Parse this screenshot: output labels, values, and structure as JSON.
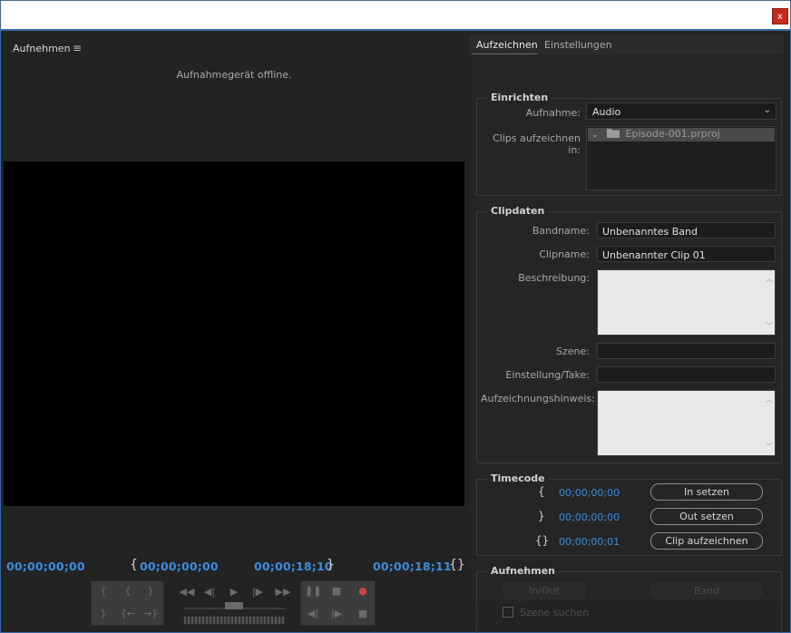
{
  "window": {
    "close_label": "x"
  },
  "panel": {
    "title": "Aufnehmen",
    "menu_icon": "≡",
    "status": "Aufnahmegerät offline."
  },
  "monitor": {
    "tc_left": "00;00;00;00",
    "tc_in": "00;00;00;00",
    "tc_out": "00;00;18;10",
    "tc_duration": "00;00;18;11",
    "in_bracket": "{",
    "out_bracket": "}",
    "dur_bracket": "{}"
  },
  "controls": {
    "set_in": "{",
    "set_out": "}",
    "rewind": "◀◀",
    "step_back": "◀|",
    "play": "▶",
    "step_fwd": "|▶",
    "ffwd": "▶▶",
    "pause": "❚❚",
    "stop": "■",
    "record": "●",
    "goto_in": "{←",
    "goto_out": "→}",
    "prev_scene": "◀|",
    "next_scene": "|▶"
  },
  "tabs": [
    "Aufzeichnen",
    "Einstellungen"
  ],
  "setup": {
    "legend": "Einrichten",
    "capture_label": "Aufnahme:",
    "capture_value": "Audio",
    "clips_label": "Clips aufzeichnen in:",
    "project": "Episode-001.prproj"
  },
  "clipdata": {
    "legend": "Clipdaten",
    "tape_label": "Bandname:",
    "tape_value": "Unbenanntes Band",
    "clip_label": "Clipname:",
    "clip_value": "Unbenannter Clip 01",
    "desc_label": "Beschreibung:",
    "scene_label": "Szene:",
    "shot_label": "Einstellung/Take:",
    "note_label": "Aufzeichnungshinweis:"
  },
  "timecode": {
    "legend": "Timecode",
    "in_value": "00;00;00;00",
    "out_value": "00;00;00;00",
    "dur_value": "00;00;00;01",
    "set_in_btn": "In setzen",
    "set_out_btn": "Out setzen",
    "log_clip_btn": "Clip aufzeichnen"
  },
  "capture": {
    "legend": "Aufnehmen",
    "inout_btn": "In/Out",
    "tape_btn": "Band",
    "scene_detect": "Szene suchen"
  },
  "colors": {
    "timecode": "#3d8ee0",
    "record": "#c44a3c",
    "accent_border": "#3a6aa5"
  }
}
